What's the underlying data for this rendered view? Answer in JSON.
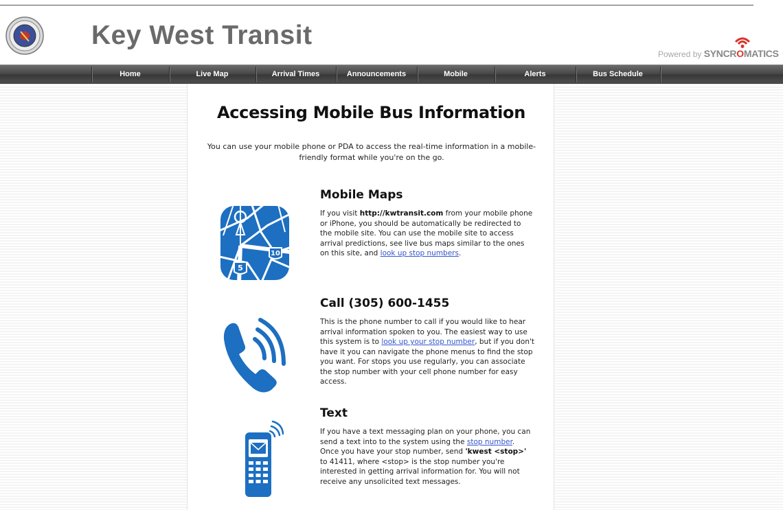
{
  "header": {
    "site_title": "Key West Transit",
    "powered_prefix": "Powered by",
    "brand_part1": "SYNCR",
    "brand_part2": "O",
    "brand_part3": "MATICS"
  },
  "nav": {
    "items": [
      "Home",
      "Live Map",
      "Arrival Times",
      "Announcements",
      "Mobile",
      "Alerts",
      "Bus Schedule"
    ]
  },
  "main": {
    "title": "Accessing Mobile Bus Information",
    "intro": "You can use your mobile phone or PDA to access the real-time information in a mobile-friendly format while you're on the go.",
    "maps": {
      "title": "Mobile Maps",
      "text_1": "If you visit ",
      "url": "http://kwtransit.com",
      "text_2": " from your mobile phone or iPhone, you should be automatically be redirected to the mobile site. You can use the mobile site to access arrival predictions, see live bus maps similar to the ones on this site, and ",
      "link": "look up stop numbers",
      "text_3": ".",
      "icon_labels": [
        "10",
        "5"
      ]
    },
    "call": {
      "title": "Call (305) 600-1455",
      "text_1": "This is the phone number to call if you would like to hear arrival information spoken to you. The easiest way to use this system is to ",
      "link": "look up your stop number",
      "text_2": ", but if you don't have it you can navigate the phone menus to find the stop you want. For stops you use regularly, you can associate the stop number with your cell phone number for easy access."
    },
    "text": {
      "title": "Text",
      "text_1": "If you have a text messaging plan on your phone, you can send a text into to the system using the ",
      "link": "stop number",
      "text_2": ". Once you have your stop number, send ",
      "command": "'kwest <stop>'",
      "text_3": " to 41411, where <stop> is the stop number you're interested in getting arrival information for. You will not receive any unsolicited text messages."
    }
  },
  "colors": {
    "icon_blue": "#1d6fc1",
    "link": "#3355cc",
    "brand_red": "#d8332b"
  }
}
